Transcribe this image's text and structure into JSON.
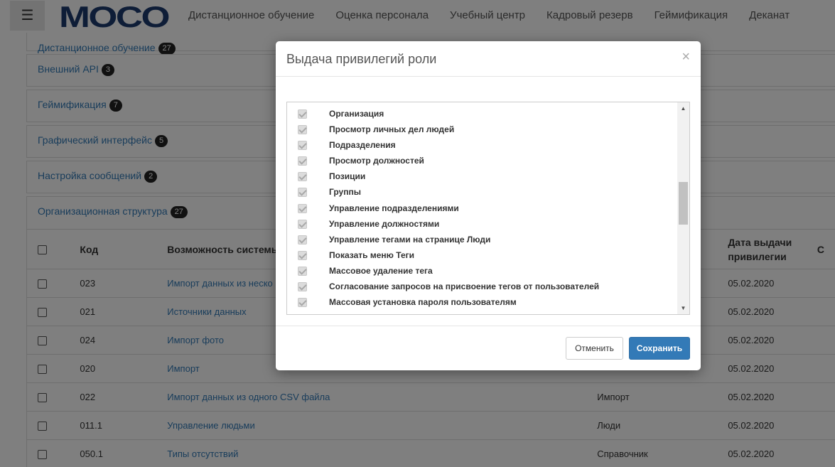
{
  "nav": {
    "menu_icon": "hamburger-menu-icon",
    "logo_text": "MOCO",
    "links": [
      "Дистанционное обучение",
      "Оценка персонала",
      "Учебный центр",
      "Кадровый резерв",
      "Геймификация",
      "Деканат"
    ]
  },
  "panels": [
    {
      "title": "Дистанционное обучение",
      "count": "27"
    },
    {
      "title": "Внешний API",
      "count": "3"
    },
    {
      "title": "Геймификация",
      "count": "7"
    },
    {
      "title": "Графический интерфейс",
      "count": "5"
    },
    {
      "title": "Настройка сообщений",
      "count": "2"
    },
    {
      "title": "Организационная структура",
      "count": "27"
    }
  ],
  "table": {
    "headers": {
      "code": "Код",
      "capability": "Возможность системы",
      "date": "Дата выдачи привилегии",
      "extra": "С"
    },
    "rows": [
      {
        "code": "023",
        "capability": "Импорт данных из неско",
        "section": "",
        "date": "05.02.2020"
      },
      {
        "code": "021",
        "capability": "Источники данных",
        "section": "",
        "date": "05.02.2020"
      },
      {
        "code": "024",
        "capability": "Импорт фото",
        "section": "",
        "date": "05.02.2020"
      },
      {
        "code": "020",
        "capability": "Импорт",
        "section": "",
        "date": "05.02.2020"
      },
      {
        "code": "022",
        "capability": "Импорт данных из одного CSV файла",
        "section": "Импорт",
        "date": "05.02.2020"
      },
      {
        "code": "011.1",
        "capability": "Управление людьми",
        "section": "Люди",
        "date": "05.02.2020"
      },
      {
        "code": "050.1",
        "capability": "Типы отсутствий",
        "section": "Справочник",
        "date": "05.02.2020"
      }
    ]
  },
  "modal": {
    "title": "Выдача привилегий роли",
    "close_symbol": "×",
    "items": [
      "Организация",
      "Просмотр личных дел людей",
      "Подразделения",
      "Просмотр должностей",
      "Позиции",
      "Группы",
      "Управление подразделениями",
      "Управление должностями",
      "Управление тегами на странице Люди",
      "Показать меню Теги",
      "Массовое удаление тега",
      "Согласование запросов на присвоение тегов от пользователей",
      "Массовая установка пароля пользователям"
    ],
    "scroll_up": "▲",
    "scroll_down": "▼",
    "cancel_label": "Отменить",
    "save_label": "Сохранить"
  }
}
